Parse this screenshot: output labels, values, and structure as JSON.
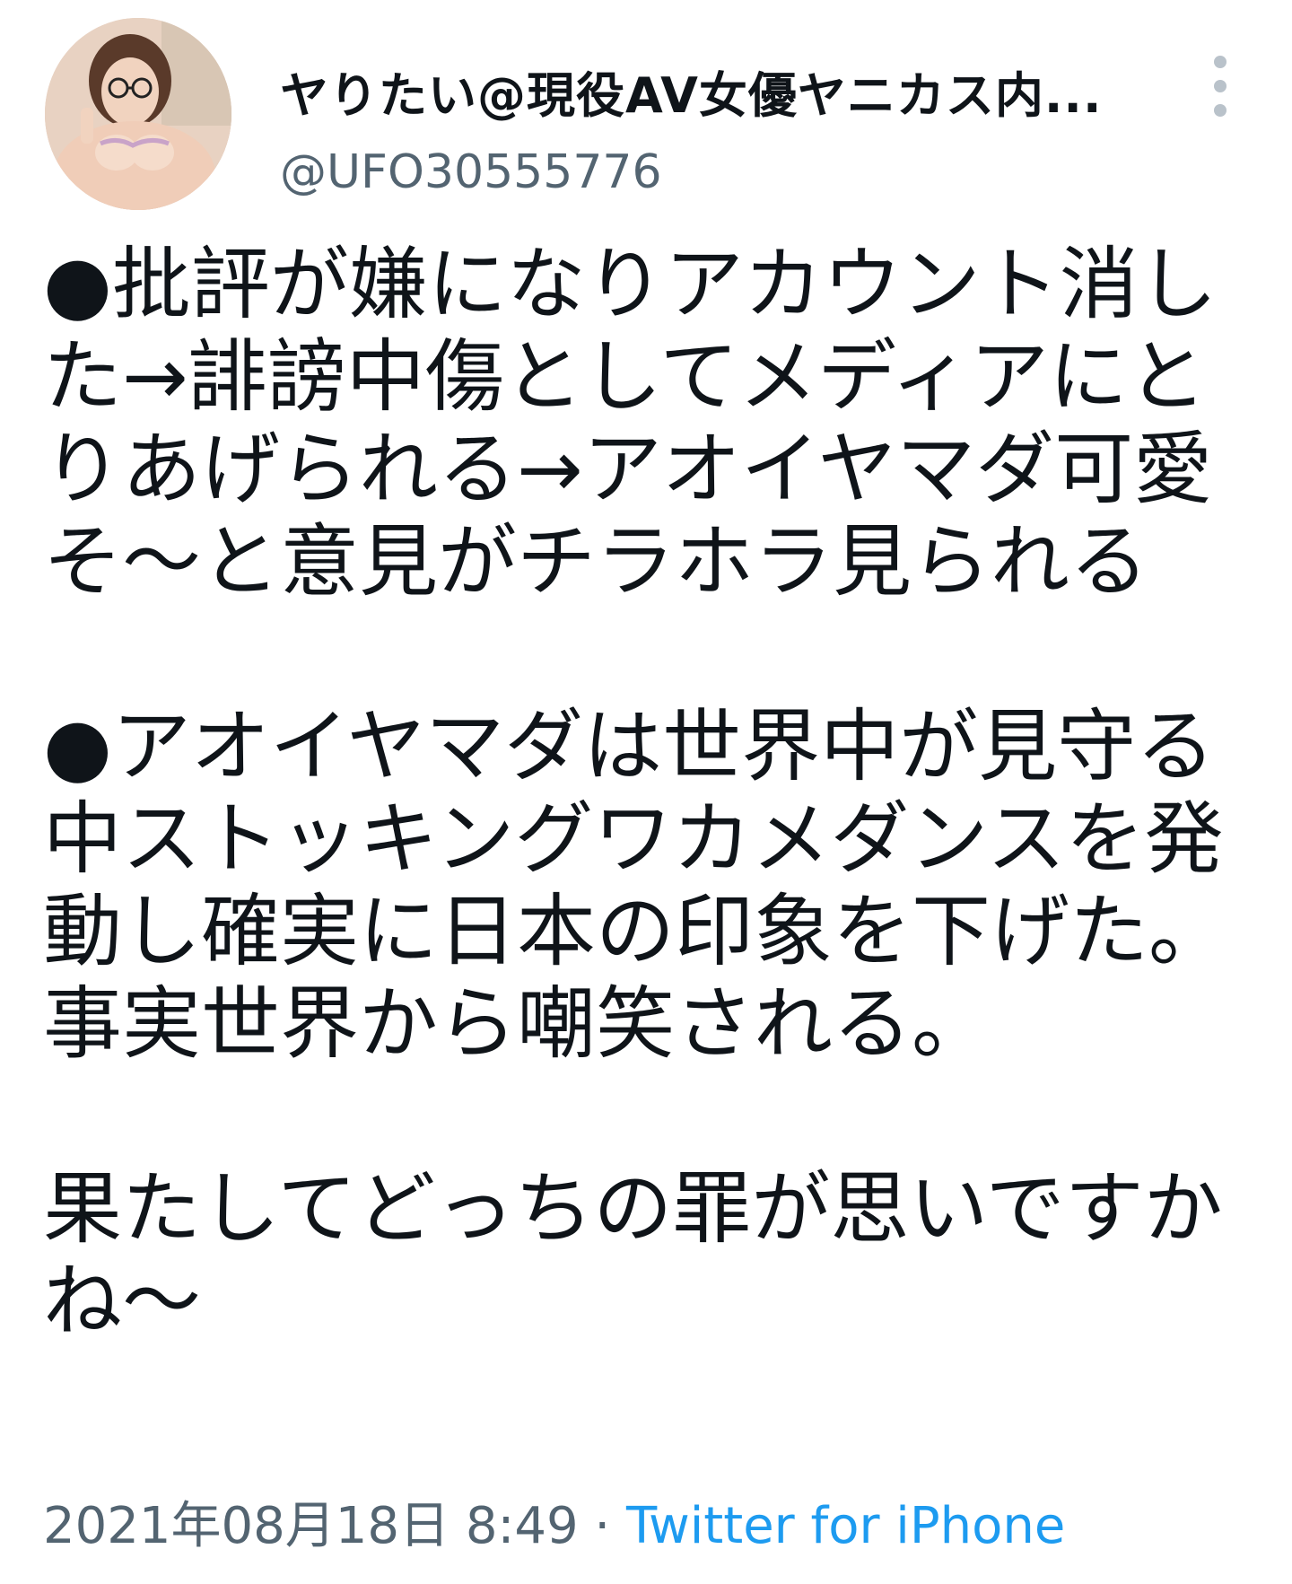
{
  "author": {
    "display_name": "ヤりたい@現役AV女優ヤニカス内...",
    "handle": "@UFO30555776"
  },
  "tweet": {
    "paragraphs": [
      [
        "●批評が嫌になりアカウント消し",
        "た→誹謗中傷としてメディアにと",
        "りあげられる→アオイヤマダ可愛",
        "そ〜と意見がチラホラ見られる"
      ],
      [
        "●アオイヤマダは世界中が見守る",
        "中ストッキングワカメダンスを発",
        "動し確実に日本の印象を下げた。",
        "事実世界から嘲笑される。"
      ],
      [
        "果たしてどっちの罪が思いですか",
        "ね〜"
      ]
    ]
  },
  "meta": {
    "timestamp": "2021年08月18日 8:49",
    "separator": " · ",
    "source": "Twitter for iPhone"
  },
  "colors": {
    "text": "#0f1419",
    "secondary": "#536471",
    "link": "#1d9bf0"
  },
  "icons": {
    "more": "more-vertical-icon"
  }
}
